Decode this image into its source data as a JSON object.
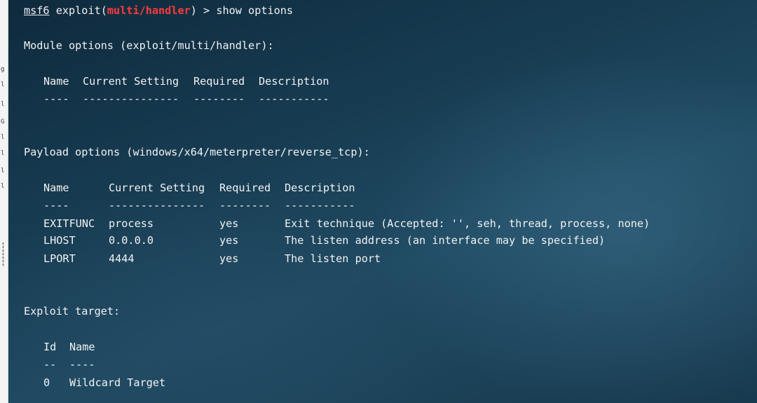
{
  "prompt": {
    "msf_label": "msf6",
    "exploit_prefix": " exploit(",
    "module_name": "multi/handler",
    "exploit_suffix": ") > ",
    "command": "show options"
  },
  "module_options": {
    "heading": "Module options (exploit/multi/handler):",
    "headers": [
      "Name",
      "Current Setting",
      "Required",
      "Description"
    ],
    "dividers": [
      "----",
      "---------------",
      "--------",
      "-----------"
    ]
  },
  "payload_options": {
    "heading": "Payload options (windows/x64/meterpreter/reverse_tcp):",
    "headers": [
      "Name",
      "Current Setting",
      "Required",
      "Description"
    ],
    "dividers": [
      "----",
      "---------------",
      "--------",
      "-----------"
    ],
    "rows": [
      {
        "name": "EXITFUNC",
        "setting": "process",
        "required": "yes",
        "description": "Exit technique (Accepted: '', seh, thread, process, none)"
      },
      {
        "name": "LHOST",
        "setting": "0.0.0.0",
        "required": "yes",
        "description": "The listen address (an interface may be specified)"
      },
      {
        "name": "LPORT",
        "setting": "4444",
        "required": "yes",
        "description": "The listen port"
      }
    ]
  },
  "exploit_target": {
    "heading": "Exploit target:",
    "headers": [
      "Id",
      "Name"
    ],
    "dividers": [
      "--",
      "----"
    ],
    "rows": [
      {
        "id": "0",
        "name": "Wildcard Target"
      }
    ]
  },
  "colors": {
    "terminal_text": "#f2f2f2",
    "module_highlight": "#ff3b3b",
    "background_dark": "#0f2a3d",
    "background_light": "#1f4a62"
  }
}
